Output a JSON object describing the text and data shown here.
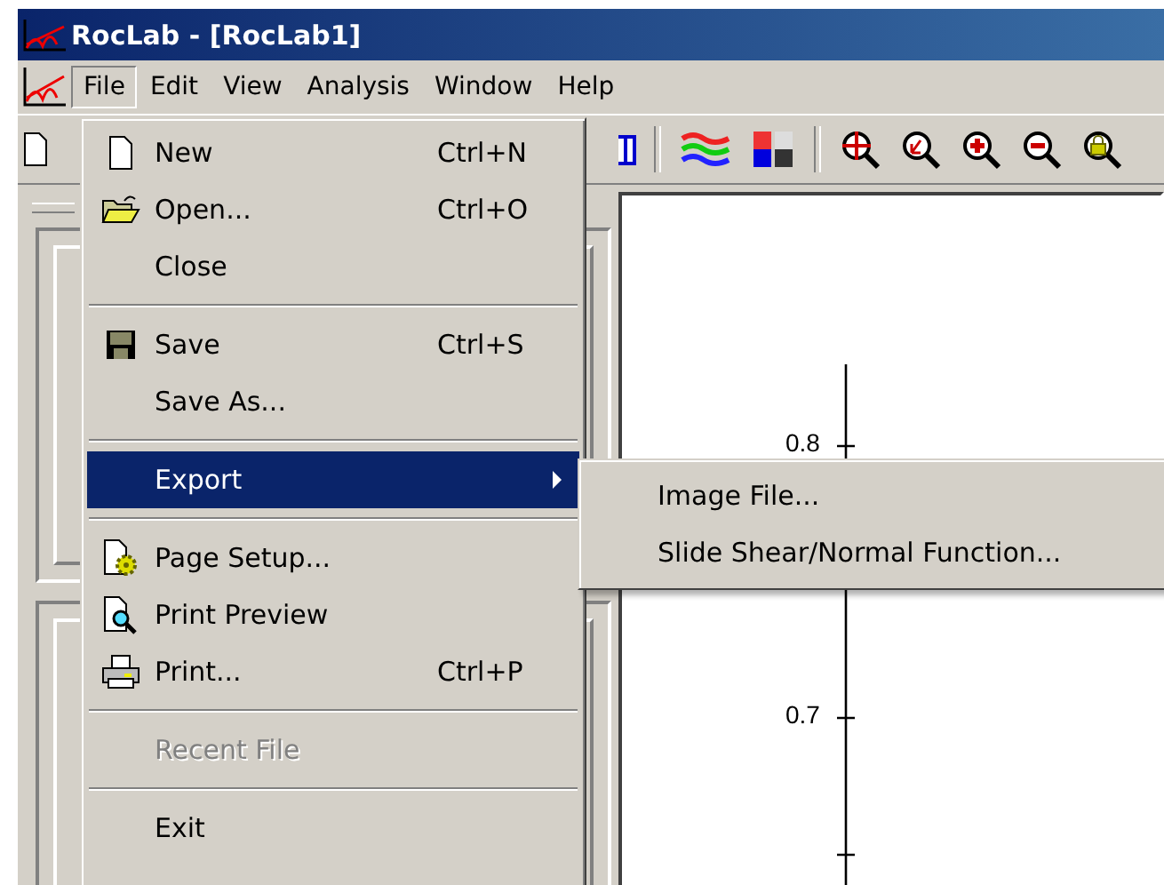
{
  "window": {
    "title": "RocLab - [RocLab1]"
  },
  "menu_bar": [
    {
      "label": "File",
      "selected": true
    },
    {
      "label": "Edit",
      "selected": false
    },
    {
      "label": "View",
      "selected": false
    },
    {
      "label": "Analysis",
      "selected": false
    },
    {
      "label": "Window",
      "selected": false
    },
    {
      "label": "Help",
      "selected": false
    }
  ],
  "file_menu": [
    {
      "kind": "item",
      "label": "New",
      "shortcut": "Ctrl+N",
      "selected": false,
      "disabled": false,
      "submenu": false
    },
    {
      "kind": "item",
      "label": "Open...",
      "shortcut": "Ctrl+O",
      "selected": false,
      "disabled": false,
      "submenu": false
    },
    {
      "kind": "item",
      "label": "Close",
      "selected": false,
      "disabled": false,
      "submenu": false
    },
    {
      "kind": "separator"
    },
    {
      "kind": "item",
      "label": "Save",
      "shortcut": "Ctrl+S",
      "selected": false,
      "disabled": false,
      "submenu": false
    },
    {
      "kind": "item",
      "label": "Save As...",
      "selected": false,
      "disabled": false,
      "submenu": false
    },
    {
      "kind": "separator"
    },
    {
      "kind": "item",
      "label": "Export",
      "selected": true,
      "disabled": false,
      "submenu": true
    },
    {
      "kind": "separator"
    },
    {
      "kind": "item",
      "label": "Page Setup...",
      "selected": false,
      "disabled": false,
      "submenu": false
    },
    {
      "kind": "item",
      "label": "Print Preview",
      "selected": false,
      "disabled": false,
      "submenu": false
    },
    {
      "kind": "item",
      "label": "Print...",
      "shortcut": "Ctrl+P",
      "selected": false,
      "disabled": false,
      "submenu": false
    },
    {
      "kind": "separator"
    },
    {
      "kind": "item",
      "label": "Recent File",
      "selected": false,
      "disabled": true,
      "submenu": false
    },
    {
      "kind": "separator"
    },
    {
      "kind": "item",
      "label": "Exit",
      "selected": false,
      "disabled": false,
      "submenu": false
    }
  ],
  "export_submenu": [
    {
      "label": "Image File..."
    },
    {
      "label": "Slide Shear/Normal Function..."
    }
  ],
  "chart": {
    "y_tick_labels": [
      "0.8",
      "0.7"
    ]
  }
}
